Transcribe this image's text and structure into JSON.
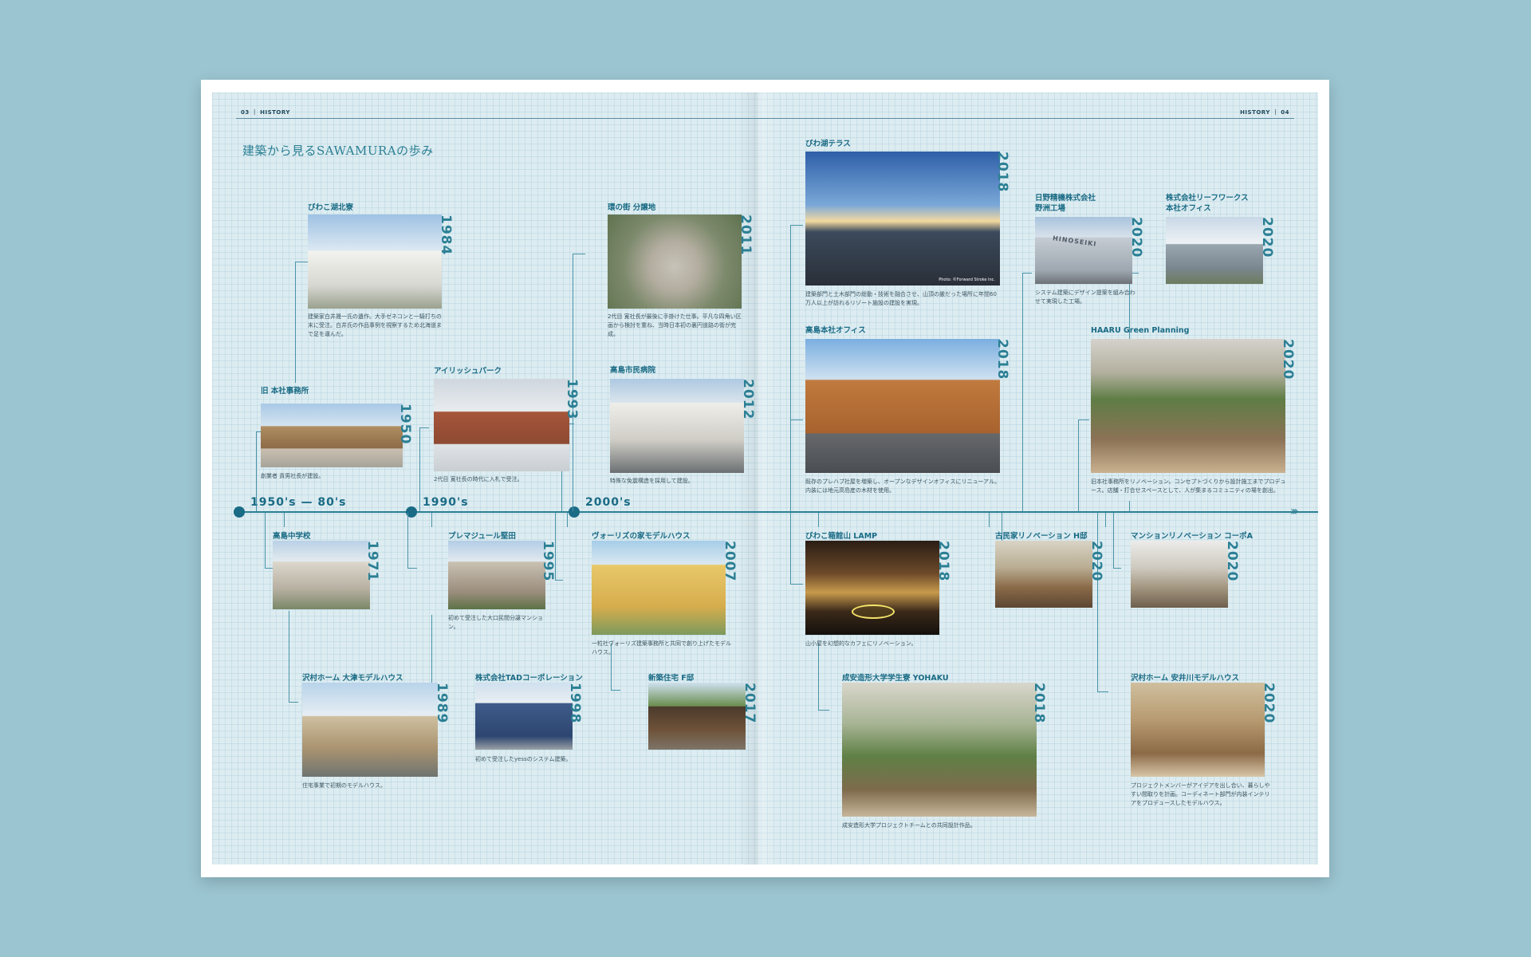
{
  "header": {
    "left": "03 ｜ HISTORY",
    "right": "HISTORY ｜ 04"
  },
  "title": "建築から見るSAWAMURAの歩み",
  "eras": [
    "1950's — 80's",
    "1990's",
    "2000's"
  ],
  "entries": {
    "biwako_hokuryo": {
      "title": "びわこ湖北寮",
      "year": "1984",
      "desc": "建築家白井晟一氏の遺作。大手ゼネコンと一騎打ちの末に受注。白井氏の作品事例を視察するため北海道まで足を運んだ。"
    },
    "kyu_honsha": {
      "title": "旧 本社事務所",
      "year": "1950",
      "desc": "創業者 貢男社長が建設。"
    },
    "koshima_chugakko": {
      "title": "高島中学校",
      "year": "1971",
      "desc": ""
    },
    "sawamura_otsu": {
      "title": "沢村ホーム 大津モデルハウス",
      "year": "1989",
      "desc": "住宅事業で初期のモデルハウス。"
    },
    "irish_park": {
      "title": "アイリッシュパーク",
      "year": "1993",
      "desc": "2代目 寛社長の時代に入札で受注。"
    },
    "premajour": {
      "title": "プレマジュール堅田",
      "year": "1995",
      "desc": "初めて受注した大口民間分譲マンション。"
    },
    "tad": {
      "title": "株式会社TADコーポレーション",
      "year": "1998",
      "desc": "初めて受注したyessのシステム建築。"
    },
    "kan_no_machi": {
      "title": "環の街 分譲地",
      "year": "2011",
      "desc": "2代目 寛社長が最後に手掛けた仕事。平凡な四角い区画から検討を重ね、当時日本初の裏円道路の街が完成。"
    },
    "takashima_hospital": {
      "title": "高島市民病院",
      "year": "2012",
      "desc": "特殊な免震構造を採用して建設。"
    },
    "vories": {
      "title": "ヴォーリズの家モデルハウス",
      "year": "2007",
      "desc": "一粒社ヴォーリズ建築事務所と共同で創り上げたモデルハウス。"
    },
    "shinchiku_f": {
      "title": "新築住宅 F邸",
      "year": "2017",
      "desc": ""
    },
    "biwako_terrace": {
      "title": "びわ湖テラス",
      "year": "2018",
      "desc": "建築部門と土木部門の総動・技術を融合させ、山頂の厳だった場所に年間60万人以上が訪れるリゾート施設の建設を実現。",
      "credit": "Photo: ©Forward Stroke Inc."
    },
    "takashima_office": {
      "title": "高島本社オフィス",
      "year": "2018",
      "desc": "既存のプレハブ社屋を増築し、オープンなデザインオフィスにリニューアル。内装には地元高島産の木材を使用。"
    },
    "biwako_hakodate": {
      "title": "びわこ箱館山 LAMP",
      "year": "2018",
      "desc": "山小屋を幻想的なカフェにリノベーション。"
    },
    "seian": {
      "title": "成安造形大学学生寮 YOHAKU",
      "year": "2018",
      "desc": "成安造形大学プロジェクトチームとの共同設計作品。"
    },
    "hino": {
      "title": "日野精機株式会社\n野洲工場",
      "year": "2020",
      "desc": "システム建築にデザイン提案を組み合わせて実現した工場。",
      "sign": "HINOSEIKI"
    },
    "leafworks": {
      "title": "株式会社リーフワークス\n本社オフィス",
      "year": "2020",
      "desc": ""
    },
    "haaru": {
      "title": "HAARU Green Planning",
      "year": "2020",
      "desc": "旧本社事務所をリノベーション。コンセプトづくりから設計施工までプロデュース。店舗・打合せスペースとして、人が集まるコミュニティの場を創出。"
    },
    "kominka": {
      "title": "古民家リノベーション H邸",
      "year": "2020",
      "desc": ""
    },
    "mansion": {
      "title": "マンションリノベーション コーポA",
      "year": "2020",
      "desc": ""
    },
    "yasugawa": {
      "title": "沢村ホーム 安井川モデルハウス",
      "year": "2020",
      "desc": "プロジェクトメンバーがアイデアを出し合い、暮らしやすい間取りを計画。コーディネート部門が内装インテリアをプロデュースしたモデルハウス。"
    }
  },
  "colors": {
    "accent": "#2b7f94",
    "dark": "#1a6b85",
    "paper": "#dcecf1",
    "background": "#9bc5d1"
  }
}
